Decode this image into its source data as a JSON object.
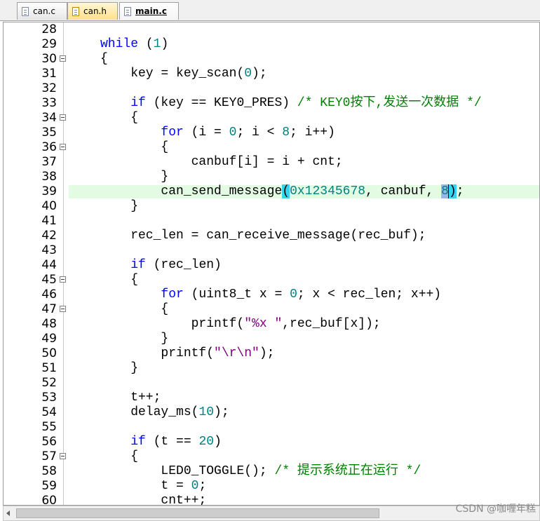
{
  "tabs": [
    {
      "label": "can.c",
      "icon": "c-file-icon"
    },
    {
      "label": "can.h",
      "icon": "h-file-icon"
    },
    {
      "label": "main.c",
      "icon": "c-file-icon",
      "active": true
    }
  ],
  "lines": [
    {
      "n": "28",
      "fold": false,
      "html": ""
    },
    {
      "n": "29",
      "fold": false,
      "html": "<span class=\"kw\">while</span> (<span class=\"num\">1</span>)"
    },
    {
      "n": "30",
      "fold": true,
      "html": "{"
    },
    {
      "n": "31",
      "fold": false,
      "html": "    key = key_scan(<span class=\"num\">0</span>);"
    },
    {
      "n": "32",
      "fold": false,
      "html": ""
    },
    {
      "n": "33",
      "fold": false,
      "html": "    <span class=\"kw\">if</span> (key == KEY0_PRES) <span class=\"cmt\">/* KEY0按下,发送一次数据 */</span>"
    },
    {
      "n": "34",
      "fold": true,
      "html": "    {"
    },
    {
      "n": "35",
      "fold": false,
      "html": "        <span class=\"kw\">for</span> (i = <span class=\"num\">0</span>; i &lt; <span class=\"num\">8</span>; i++)"
    },
    {
      "n": "36",
      "fold": true,
      "html": "        {"
    },
    {
      "n": "37",
      "fold": false,
      "html": "            canbuf[i] = i + cnt;"
    },
    {
      "n": "38",
      "fold": false,
      "html": "        }"
    },
    {
      "n": "39",
      "fold": false,
      "current": true,
      "html": "        can_send_message<span class=\"brace\">(</span><span class=\"num\">0x12345678</span>, canbuf, <span class=\"num sel\">8</span><span class=\"brace caret\">)</span>;"
    },
    {
      "n": "40",
      "fold": false,
      "html": "    }"
    },
    {
      "n": "41",
      "fold": false,
      "html": ""
    },
    {
      "n": "42",
      "fold": false,
      "html": "    rec_len = can_receive_message(rec_buf);"
    },
    {
      "n": "43",
      "fold": false,
      "html": ""
    },
    {
      "n": "44",
      "fold": false,
      "html": "    <span class=\"kw\">if</span> (rec_len)"
    },
    {
      "n": "45",
      "fold": true,
      "html": "    {"
    },
    {
      "n": "46",
      "fold": false,
      "html": "        <span class=\"kw\">for</span> (uint8_t x = <span class=\"num\">0</span>; x &lt; rec_len; x++)"
    },
    {
      "n": "47",
      "fold": true,
      "html": "        {"
    },
    {
      "n": "48",
      "fold": false,
      "html": "            printf(<span class=\"str\">\"%x \"</span>,rec_buf[x]);"
    },
    {
      "n": "49",
      "fold": false,
      "html": "        }"
    },
    {
      "n": "50",
      "fold": false,
      "html": "        printf(<span class=\"str\">\"\\r\\n\"</span>);"
    },
    {
      "n": "51",
      "fold": false,
      "html": "    }"
    },
    {
      "n": "52",
      "fold": false,
      "html": ""
    },
    {
      "n": "53",
      "fold": false,
      "html": "    t++;"
    },
    {
      "n": "54",
      "fold": false,
      "html": "    delay_ms(<span class=\"num\">10</span>);"
    },
    {
      "n": "55",
      "fold": false,
      "html": ""
    },
    {
      "n": "56",
      "fold": false,
      "html": "    <span class=\"kw\">if</span> (t == <span class=\"num\">20</span>)"
    },
    {
      "n": "57",
      "fold": true,
      "html": "    {"
    },
    {
      "n": "58",
      "fold": false,
      "html": "        LED0_TOGGLE(); <span class=\"cmt\">/* 提示系统正在运行 */</span>"
    },
    {
      "n": "59",
      "fold": false,
      "html": "        t = <span class=\"num\">0</span>;"
    },
    {
      "n": "60",
      "fold": false,
      "html": "        cnt++;"
    }
  ],
  "watermark": "CSDN @咖喱年糕",
  "colors": {
    "keyword": "#0000ff",
    "number": "#008080",
    "string": "#800080",
    "comment": "#008000",
    "current_line": "#e3fbe3",
    "brace_match": "#34d3ee"
  }
}
